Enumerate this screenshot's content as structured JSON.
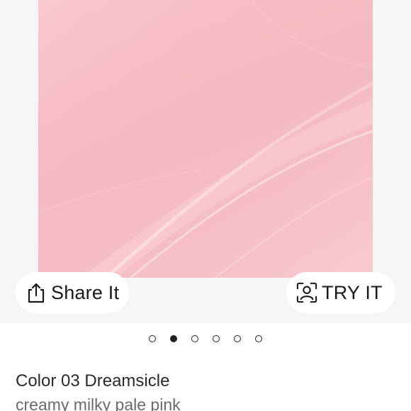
{
  "product": {
    "swatch_color": "#f4b9c0",
    "share_label": "Share It",
    "share_icon": "share-icon",
    "try_label": "TRY IT",
    "try_icon": "face-scan-icon",
    "carousel": {
      "total": 6,
      "active_index": 1
    },
    "color_prefix": "Color",
    "color_name": "03 Dreamsicle",
    "description": "creamy milky pale pink"
  }
}
